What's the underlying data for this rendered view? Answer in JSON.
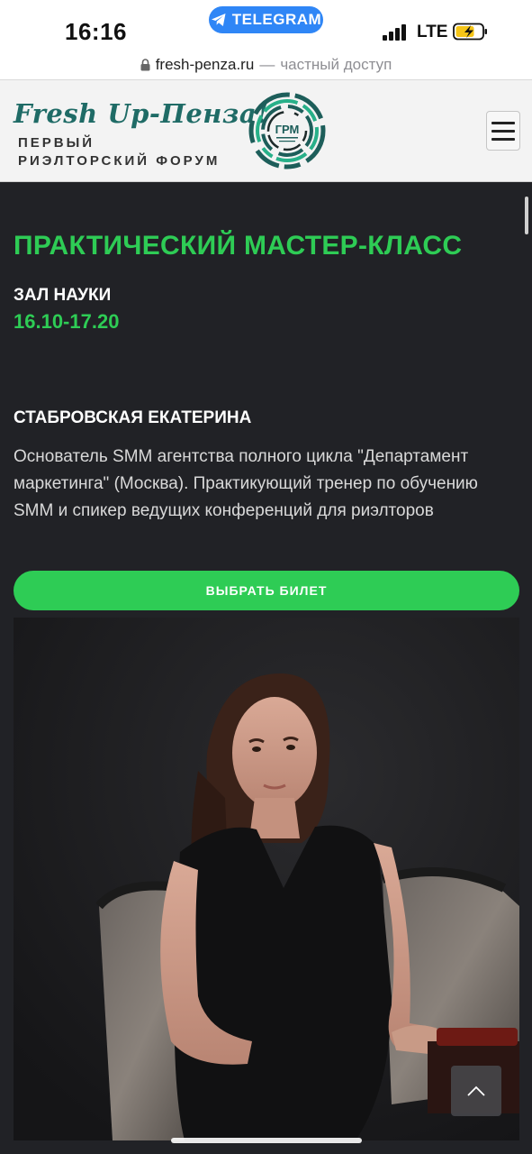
{
  "status_bar": {
    "time": "16:16",
    "telegram_label": "TELEGRAM",
    "network": "LTE"
  },
  "url_bar": {
    "host": "fresh-penza.ru",
    "separator": "—",
    "subtitle": "частный доступ"
  },
  "header": {
    "brand_title": "Fresh Up-Пенза!",
    "brand_sub_line1": "ПЕРВЫЙ",
    "brand_sub_line2": "РИЭЛТОРСКИЙ ФОРУМ",
    "logo_text": "ГРМ",
    "menu_icon": "hamburger-icon"
  },
  "event": {
    "title": "ПРАКТИЧЕСКИЙ МАСТЕР-КЛАСС",
    "hall": "ЗАЛ НАУКИ",
    "time_range": "16.10-17.20"
  },
  "speaker": {
    "name": "СТАБРОВСКАЯ ЕКАТЕРИНА",
    "description": "Основатель SMM агентства полного цикла \"Департамент маркетинга\" (Москва).  Практикующий тренер по обучению SMM и спикер ведущих конференций для риэлторов"
  },
  "cta": {
    "ticket_label": "ВЫБРАТЬ БИЛЕТ"
  },
  "colors": {
    "accent_green": "#2ecc55",
    "dark_bg": "#212226",
    "brand_teal": "#1f6b66",
    "telegram_blue": "#2f86f6"
  }
}
